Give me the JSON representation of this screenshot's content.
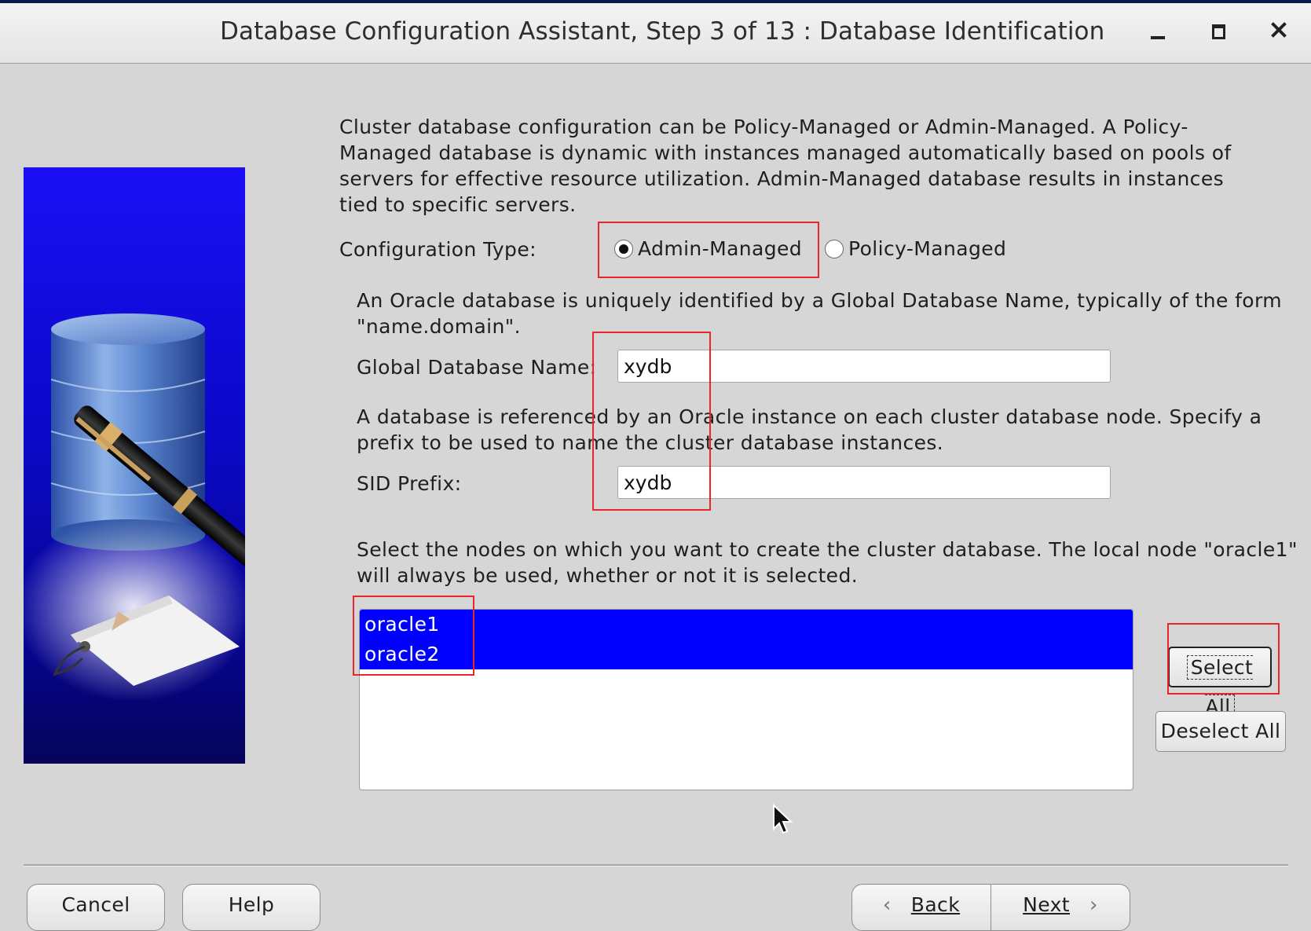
{
  "window": {
    "title": "Database Configuration Assistant, Step 3 of 13 : Database Identification"
  },
  "content": {
    "description_cluster": "Cluster database configuration can be Policy-Managed or Admin-Managed. A Policy-Managed database is dynamic with instances managed automatically based on pools of servers for effective resource utilization. Admin-Managed database results in instances tied to specific servers.",
    "configuration_type_label": "Configuration Type:",
    "radio_admin_label": "Admin-Managed",
    "radio_policy_label": "Policy-Managed",
    "selected_configuration": "Admin-Managed",
    "description_gdn": "An Oracle database is uniquely identified by a Global Database Name, typically of the form \"name.domain\".",
    "global_db_name_label": "Global Database Name:",
    "global_db_name_value": "xydb",
    "description_sid": "A database is referenced by an Oracle instance on each cluster database node. Specify a prefix to be used to name the cluster database instances.",
    "sid_prefix_label": "SID Prefix:",
    "sid_prefix_value": "xydb",
    "description_nodes": "Select the nodes on which you want to create the cluster database. The local node \"oracle1\" will always be used, whether or not it is selected.",
    "nodes": [
      "oracle1",
      "oracle2"
    ],
    "select_all_label": "Select All",
    "deselect_all_label": "Deselect All"
  },
  "footer": {
    "cancel_label": "Cancel",
    "help_label": "Help",
    "back_label": "Back",
    "next_label": "Next"
  },
  "colors": {
    "selection": "#0000ff",
    "highlight_box": "#e8262b",
    "background": "#d6d6d6"
  }
}
